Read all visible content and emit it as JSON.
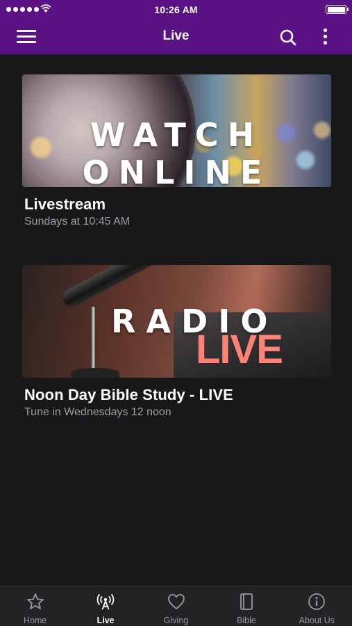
{
  "status_bar": {
    "time": "10:26 AM",
    "signal_icon": "signal-dots-icon",
    "wifi_icon": "wifi-icon",
    "battery_icon": "battery-icon"
  },
  "navbar": {
    "title": "Live",
    "menu_icon": "hamburger-menu-icon",
    "search_icon": "search-icon",
    "more_icon": "more-vertical-icon",
    "background_color": "#5a1285"
  },
  "items": [
    {
      "thumbnail_text": "WATCH ONLINE",
      "title": "Livestream",
      "subtitle": "Sundays at 10:45 AM"
    },
    {
      "thumbnail_text_1": "RADIO",
      "thumbnail_text_2": "LIVE",
      "title": "Noon Day Bible Study - LIVE",
      "subtitle": "Tune in Wednesdays 12 noon"
    }
  ],
  "tabbar": {
    "active": "Live",
    "tabs": [
      {
        "label": "Home",
        "icon": "star-icon"
      },
      {
        "label": "Live",
        "icon": "broadcast-tower-icon"
      },
      {
        "label": "Giving",
        "icon": "heart-icon"
      },
      {
        "label": "Bible",
        "icon": "book-icon"
      },
      {
        "label": "About Us",
        "icon": "info-icon"
      }
    ]
  },
  "colors": {
    "background": "#18181a",
    "tab_inactive": "#9a9aa0",
    "tab_active": "#ffffff",
    "subtitle": "#9c9ca2",
    "live_accent": "#ff8276"
  }
}
